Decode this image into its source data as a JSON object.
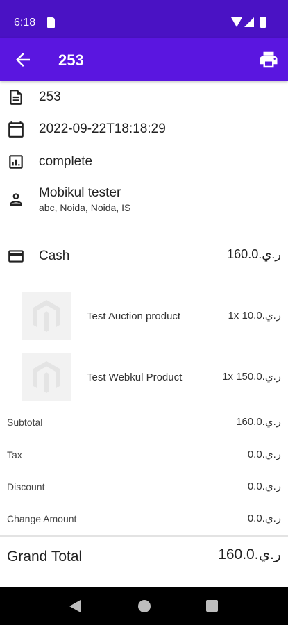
{
  "status_bar": {
    "time": "6:18"
  },
  "app_bar": {
    "title": "253",
    "back_icon": "arrow-back-icon",
    "print_icon": "printer-icon"
  },
  "order": {
    "id": "253",
    "date": "2022-09-22T18:18:29",
    "status": "complete",
    "customer_name": "Mobikul tester",
    "customer_address": "abc, Noida, Noida, IS",
    "payment_method": "Cash",
    "payment_amount": "160.0.ر.ي"
  },
  "products": [
    {
      "name": "Test Auction product",
      "qty_price": "1x 10.0.ر.ي"
    },
    {
      "name": "Test Webkul Product",
      "qty_price": "1x 150.0.ر.ي"
    }
  ],
  "totals": [
    {
      "label": "Subtotal",
      "value": "160.0.ر.ي"
    },
    {
      "label": "Tax",
      "value": "0.0.ر.ي"
    },
    {
      "label": "Discount",
      "value": "0.0.ر.ي"
    },
    {
      "label": "Change Amount",
      "value": "0.0.ر.ي"
    }
  ],
  "grand_total": {
    "label": "Grand Total",
    "value": "160.0.ر.ي"
  },
  "colors": {
    "status_bar": "#4a12c4",
    "app_bar": "#5a16e0"
  }
}
